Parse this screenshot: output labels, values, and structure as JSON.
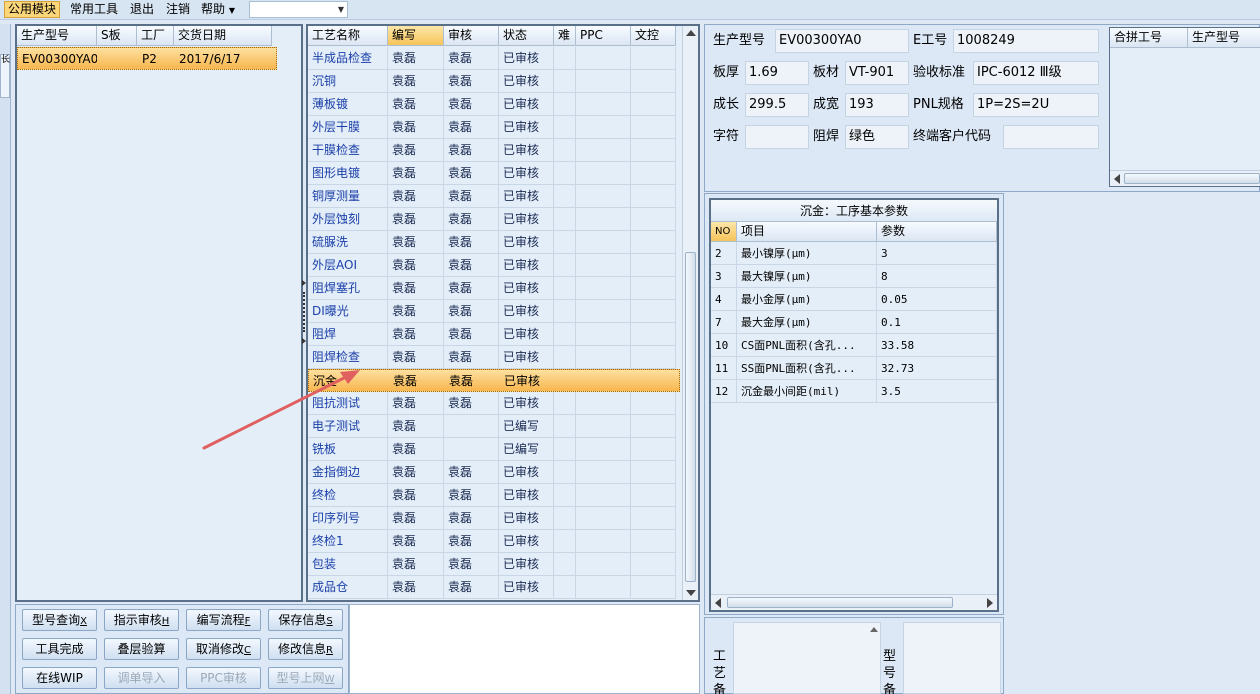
{
  "menu": {
    "items": [
      "公用模块",
      "常用工具",
      "退出",
      "注销",
      "帮助"
    ],
    "combo_value": ""
  },
  "left_strip": {
    "tab_label": "长"
  },
  "model_grid": {
    "columns": [
      "生产型号",
      "S板",
      "工厂",
      "交货日期"
    ],
    "rows": [
      {
        "model": "EV00300YA0",
        "s": "",
        "factory": "P2",
        "date": "2017/6/17"
      }
    ]
  },
  "process_grid": {
    "columns": [
      "工艺名称",
      "编写",
      "审核",
      "状态",
      "难",
      "PPC",
      "文控"
    ],
    "selected_index": 14,
    "rows": [
      {
        "name": "半成品检查",
        "writer": "袁磊",
        "reviewer": "袁磊",
        "status": "已审核"
      },
      {
        "name": "沉铜",
        "writer": "袁磊",
        "reviewer": "袁磊",
        "status": "已审核"
      },
      {
        "name": "薄板镀",
        "writer": "袁磊",
        "reviewer": "袁磊",
        "status": "已审核"
      },
      {
        "name": "外层干膜",
        "writer": "袁磊",
        "reviewer": "袁磊",
        "status": "已审核"
      },
      {
        "name": "干膜检查",
        "writer": "袁磊",
        "reviewer": "袁磊",
        "status": "已审核"
      },
      {
        "name": "图形电镀",
        "writer": "袁磊",
        "reviewer": "袁磊",
        "status": "已审核"
      },
      {
        "name": "铜厚测量",
        "writer": "袁磊",
        "reviewer": "袁磊",
        "status": "已审核"
      },
      {
        "name": "外层蚀刻",
        "writer": "袁磊",
        "reviewer": "袁磊",
        "status": "已审核"
      },
      {
        "name": "硫脲洗",
        "writer": "袁磊",
        "reviewer": "袁磊",
        "status": "已审核"
      },
      {
        "name": "外层AOI",
        "writer": "袁磊",
        "reviewer": "袁磊",
        "status": "已审核"
      },
      {
        "name": "阻焊塞孔",
        "writer": "袁磊",
        "reviewer": "袁磊",
        "status": "已审核"
      },
      {
        "name": "DI曝光",
        "writer": "袁磊",
        "reviewer": "袁磊",
        "status": "已审核"
      },
      {
        "name": "阻焊",
        "writer": "袁磊",
        "reviewer": "袁磊",
        "status": "已审核"
      },
      {
        "name": "阻焊检查",
        "writer": "袁磊",
        "reviewer": "袁磊",
        "status": "已审核"
      },
      {
        "name": "沉金",
        "writer": "袁磊",
        "reviewer": "袁磊",
        "status": "已审核"
      },
      {
        "name": "阻抗测试",
        "writer": "袁磊",
        "reviewer": "袁磊",
        "status": "已审核"
      },
      {
        "name": "电子测试",
        "writer": "袁磊",
        "reviewer": "",
        "status": "已编写"
      },
      {
        "name": "铣板",
        "writer": "袁磊",
        "reviewer": "",
        "status": "已编写"
      },
      {
        "name": "金指倒边",
        "writer": "袁磊",
        "reviewer": "袁磊",
        "status": "已审核"
      },
      {
        "name": "终检",
        "writer": "袁磊",
        "reviewer": "袁磊",
        "status": "已审核"
      },
      {
        "name": "印序列号",
        "writer": "袁磊",
        "reviewer": "袁磊",
        "status": "已审核"
      },
      {
        "name": "终检1",
        "writer": "袁磊",
        "reviewer": "袁磊",
        "status": "已审核"
      },
      {
        "name": "包装",
        "writer": "袁磊",
        "reviewer": "袁磊",
        "status": "已审核"
      },
      {
        "name": "成品仓",
        "writer": "袁磊",
        "reviewer": "袁磊",
        "status": "已审核"
      }
    ]
  },
  "buttons": [
    {
      "label": "型号查询",
      "key": "X",
      "disabled": false
    },
    {
      "label": "指示审核",
      "key": "H",
      "disabled": false
    },
    {
      "label": "编写流程",
      "key": "F",
      "disabled": false
    },
    {
      "label": "保存信息",
      "key": "S",
      "disabled": false
    },
    {
      "label": "工具完成",
      "key": "",
      "disabled": false
    },
    {
      "label": "叠层验算",
      "key": "",
      "disabled": false
    },
    {
      "label": "取消修改",
      "key": "C",
      "disabled": false
    },
    {
      "label": "修改信息",
      "key": "R",
      "disabled": false
    },
    {
      "label": "在线WIP",
      "key": "",
      "disabled": false
    },
    {
      "label": "调单导入",
      "key": "",
      "disabled": true
    },
    {
      "label": "PPC审核",
      "key": "",
      "disabled": true
    },
    {
      "label": "型号上网",
      "key": "W",
      "disabled": true
    }
  ],
  "info": {
    "model_label": "生产型号",
    "model_value": "EV00300YA0",
    "e_label": "E工号",
    "e_value": "1008249",
    "thickness_label": "板厚",
    "thickness_value": "1.69",
    "material_label": "板材",
    "material_value": "VT-901",
    "standard_label": "验收标准",
    "standard_value": "IPC-6012 Ⅲ级",
    "length_label": "成长",
    "length_value": "299.5",
    "width_label": "成宽",
    "width_value": "193",
    "pnl_label": "PNL规格",
    "pnl_value": "1P=2S=2U",
    "char_label": "字符",
    "char_value": "",
    "mask_label": "阻焊",
    "mask_value": "绿色",
    "customer_label": "终端客户代码",
    "customer_value": ""
  },
  "merge_grid": {
    "columns": [
      "合拼工号",
      "生产型号"
    ]
  },
  "param_grid": {
    "title": "沉金：工序基本参数",
    "columns": [
      "NO",
      "项目",
      "参数"
    ],
    "rows": [
      {
        "no": "2",
        "item": "最小镍厚(μm)",
        "value": "3"
      },
      {
        "no": "3",
        "item": "最大镍厚(μm)",
        "value": "8"
      },
      {
        "no": "4",
        "item": "最小金厚(μm)",
        "value": "0.05"
      },
      {
        "no": "7",
        "item": "最大金厚(μm)",
        "value": "0.1"
      },
      {
        "no": "10",
        "item": "CS面PNL面积(含孔...",
        "value": "33.58"
      },
      {
        "no": "11",
        "item": "SS面PNL面积(含孔...",
        "value": "32.73"
      },
      {
        "no": "12",
        "item": "沉金最小间距(mil)",
        "value": "3.5"
      }
    ]
  },
  "bottom_labels": {
    "process_note": "工艺备",
    "model_note": "型号备"
  },
  "colors": {
    "accent": "#f8b64e",
    "arrow": "#e06060",
    "grid_text": "#1a3fa8"
  }
}
